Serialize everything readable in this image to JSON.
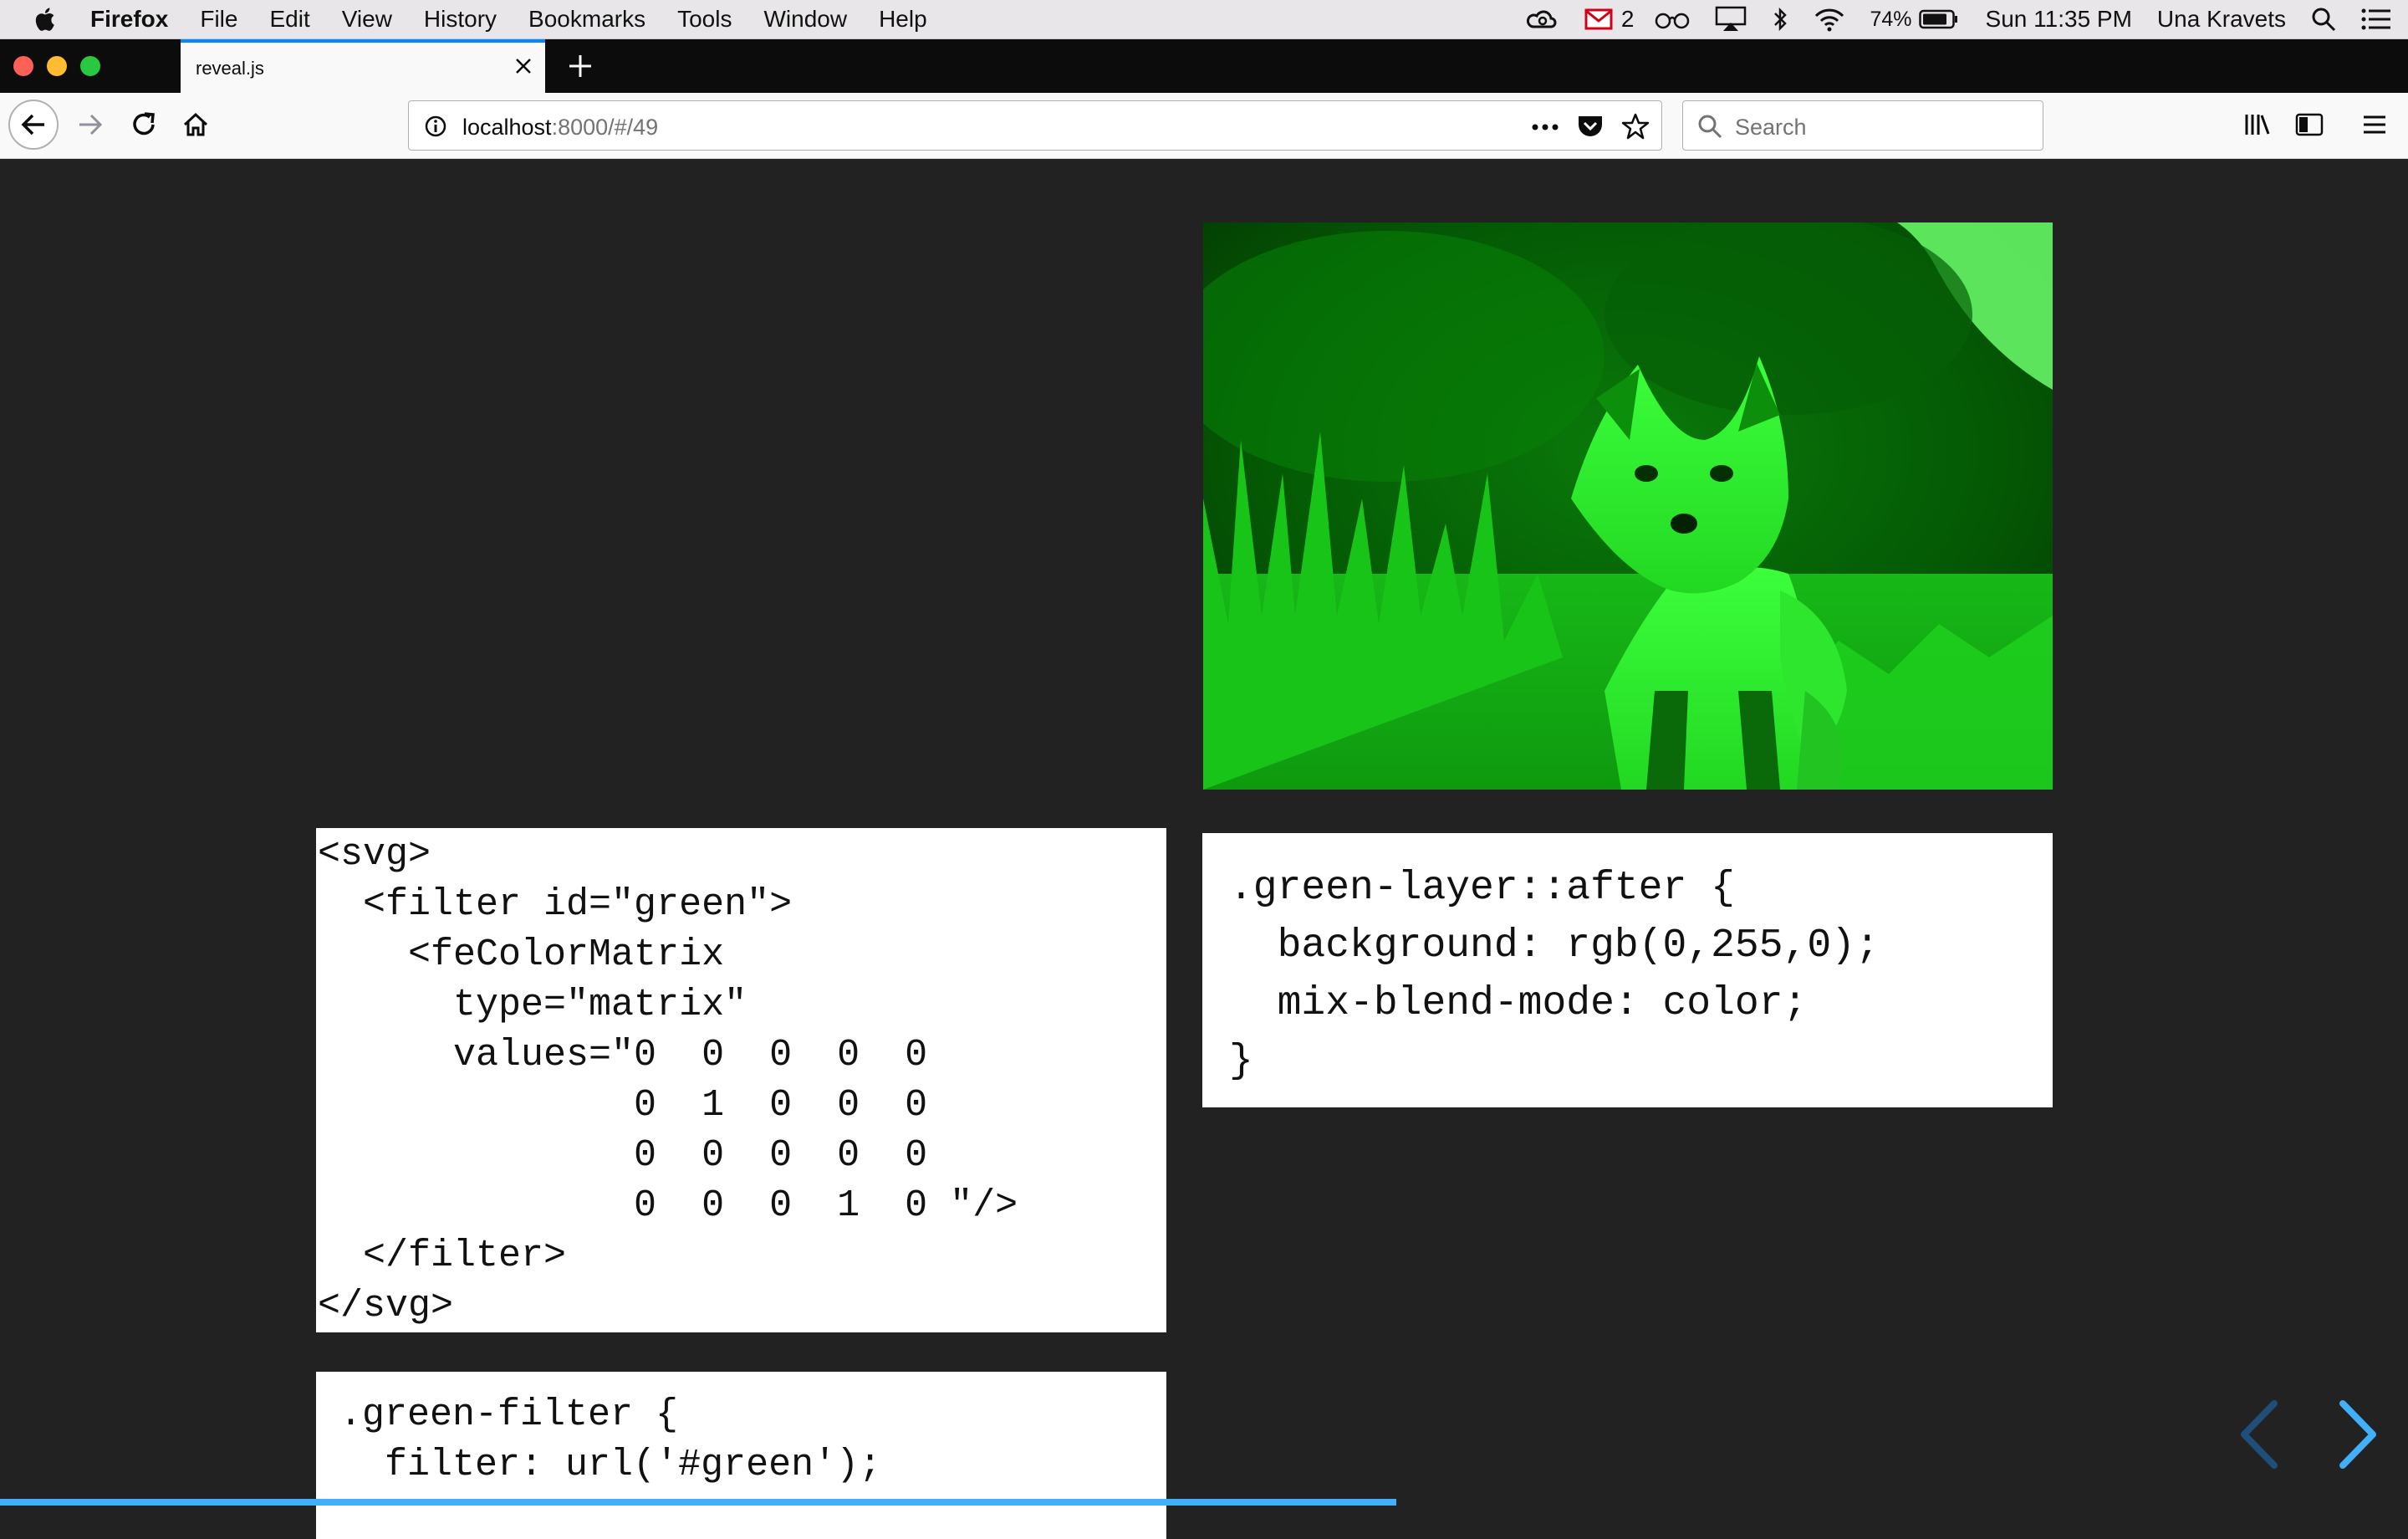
{
  "menubar": {
    "app_name": "Firefox",
    "items": [
      "File",
      "Edit",
      "View",
      "History",
      "Bookmarks",
      "Tools",
      "Window",
      "Help"
    ],
    "mail_count": "2",
    "battery": "74%",
    "clock": "Sun 11:35 PM",
    "user": "Una Kravets"
  },
  "browser": {
    "tab_title": "reveal.js",
    "url_host": "localhost",
    "url_path": ":8000/#/49",
    "search_placeholder": "Search",
    "accent_color": "#0a84ff"
  },
  "slide": {
    "code_svg": "<svg>\n  <filter id=\"green\">\n    <feColorMatrix\n      type=\"matrix\"\n      values=\"0  0  0  0  0\n              0  1  0  0  0\n              0  0  0  0  0\n              0  0  0  1  0 \"/>\n  </filter>\n</svg>",
    "code_css_layer": ".green-layer::after {\n  background: rgb(0,255,0);\n  mix-blend-mode: color;\n}",
    "code_css_filter": ".green-filter {\n  filter: url('#green');",
    "progress": 0.58,
    "progress_color": "#42affa"
  }
}
